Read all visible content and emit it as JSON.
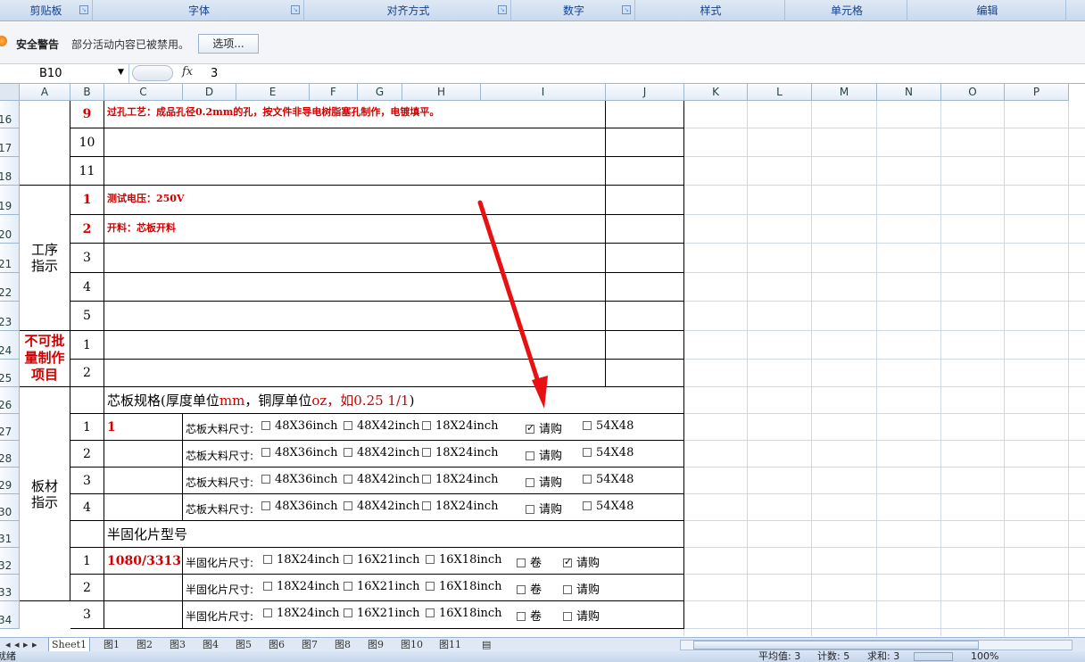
{
  "ribbon": {
    "groups": [
      "剪贴板",
      "字体",
      "对齐方式",
      "数字",
      "样式",
      "单元格",
      "编辑"
    ]
  },
  "security": {
    "title": "安全警告",
    "message": "部分活动内容已被禁用。",
    "button": "选项..."
  },
  "formula_bar": {
    "name_box": "B10",
    "fx": "fx",
    "value": "3"
  },
  "columns": [
    "A",
    "B",
    "C",
    "D",
    "E",
    "F",
    "G",
    "H",
    "I",
    "J",
    "K",
    "L",
    "M",
    "N",
    "O",
    "P"
  ],
  "rows": [
    "16",
    "17",
    "18",
    "19",
    "20",
    "21",
    "22",
    "23",
    "24",
    "25",
    "26",
    "27",
    "28",
    "29",
    "30",
    "31",
    "32",
    "33",
    "34"
  ],
  "sheet": {
    "r16": {
      "num": "9",
      "text": "过孔工艺：成品孔径0.2mm的孔，按文件非导电树脂塞孔制作，电镀填平。"
    },
    "r17": {
      "num": "10"
    },
    "r18": {
      "num": "11"
    },
    "r19": {
      "num": "1",
      "text": "测试电压：250V"
    },
    "r20": {
      "num": "2",
      "text": "开料：芯板开料"
    },
    "r21": {
      "num": "3"
    },
    "r22": {
      "num": "4"
    },
    "r23": {
      "num": "5"
    },
    "r24": {
      "num": "1"
    },
    "r25": {
      "num": "2"
    },
    "section_process": "工序\n指示",
    "section_nobatch": "不可批量制作项目",
    "section_board": "板材\n指示",
    "core_header": {
      "prefix": "芯板规格(厚度单位",
      "unit1": "mm",
      "mid": "，铜厚单位",
      "unit2": "oz",
      "suffix": "，如0.25 1/1",
      "close": ")"
    },
    "core_rows": [
      {
        "num": "1",
        "value": "1",
        "label": "芯板大料尺寸:",
        "opts": [
          "48X36inch",
          "48X42inch",
          "18X24inch",
          "请购",
          "54X48"
        ],
        "checked": [
          false,
          false,
          false,
          true,
          false
        ]
      },
      {
        "num": "2",
        "value": "",
        "label": "芯板大料尺寸:",
        "opts": [
          "48X36inch",
          "48X42inch",
          "18X24inch",
          "请购",
          "54X48"
        ],
        "checked": [
          false,
          false,
          false,
          false,
          false
        ]
      },
      {
        "num": "3",
        "value": "",
        "label": "芯板大料尺寸:",
        "opts": [
          "48X36inch",
          "48X42inch",
          "18X24inch",
          "请购",
          "54X48"
        ],
        "checked": [
          false,
          false,
          false,
          false,
          false
        ]
      },
      {
        "num": "4",
        "value": "",
        "label": "芯板大料尺寸:",
        "opts": [
          "48X36inch",
          "48X42inch",
          "18X24inch",
          "请购",
          "54X48"
        ],
        "checked": [
          false,
          false,
          false,
          false,
          false
        ]
      }
    ],
    "prepreg_header": "半固化片型号",
    "prepreg_rows": [
      {
        "num": "1",
        "value": "1080/3313",
        "label": "半固化片尺寸:",
        "opts": [
          "18X24inch",
          "16X21inch",
          "16X18inch",
          "卷",
          "请购"
        ],
        "checked": [
          false,
          false,
          false,
          false,
          true
        ]
      },
      {
        "num": "2",
        "value": "",
        "label": "半固化片尺寸:",
        "opts": [
          "18X24inch",
          "16X21inch",
          "16X18inch",
          "卷",
          "请购"
        ],
        "checked": [
          false,
          false,
          false,
          false,
          false
        ]
      },
      {
        "num": "3",
        "value": "",
        "label": "半固化片尺寸:",
        "opts": [
          "18X24inch",
          "16X21inch",
          "16X18inch",
          "卷",
          "请购"
        ],
        "checked": [
          false,
          false,
          false,
          false,
          false
        ]
      }
    ]
  },
  "tabs": [
    "Sheet1",
    "图1",
    "图2",
    "图3",
    "图4",
    "图5",
    "图6",
    "图7",
    "图8",
    "图9",
    "图10",
    "图11"
  ],
  "status": {
    "left": "就绪",
    "avg": "平均值: 3",
    "count": "计数: 5",
    "sum": "求和: 3",
    "zoom": "100%"
  },
  "colors": {
    "accent_red": "#d00000",
    "arrow": "#e81010"
  }
}
